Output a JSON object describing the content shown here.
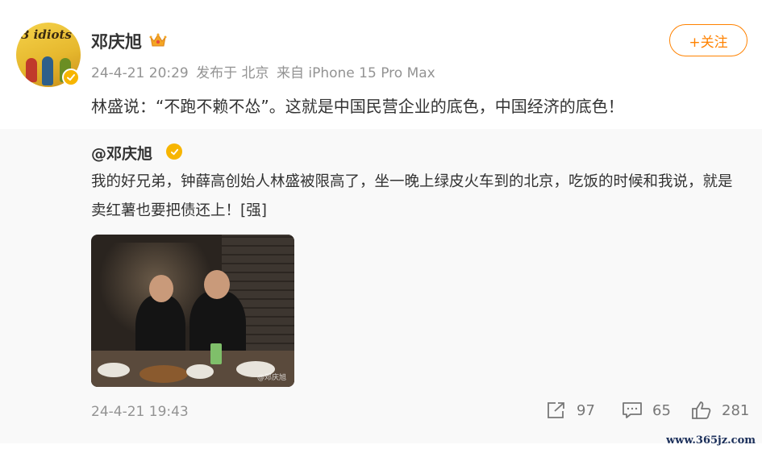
{
  "post": {
    "author": "邓庆旭",
    "avatar_text": "3 idiots",
    "meta": {
      "time": "24-4-21 20:29",
      "location": "发布于 北京",
      "source": "来自 iPhone 15 Pro Max"
    },
    "follow_label": "+关注",
    "text": "林盛说：“不跑不赖不怂”。这就是中国民营企业的底色，中国经济的底色！"
  },
  "retweet": {
    "author": "@邓庆旭",
    "text": "我的好兄弟，钟薛高创始人林盛被限高了，坐一晚上绿皮火车到的北京，吃饭的时候和我说，就是卖红薯也要把债还上！[强]",
    "photo_watermark": "@邓庆旭",
    "time": "24-4-21 19:43",
    "actions": {
      "repost_count": "97",
      "comment_count": "65",
      "like_count": "281"
    }
  },
  "site_watermark": "www.365jz.com",
  "colors": {
    "accent_orange": "#ff8200",
    "verify_gold": "#f7b500",
    "meta_gray": "#939393",
    "retweet_bg": "#f9f9f9"
  },
  "icons": [
    "crown-icon",
    "verified-icon",
    "repost-icon",
    "comment-icon",
    "like-icon"
  ]
}
